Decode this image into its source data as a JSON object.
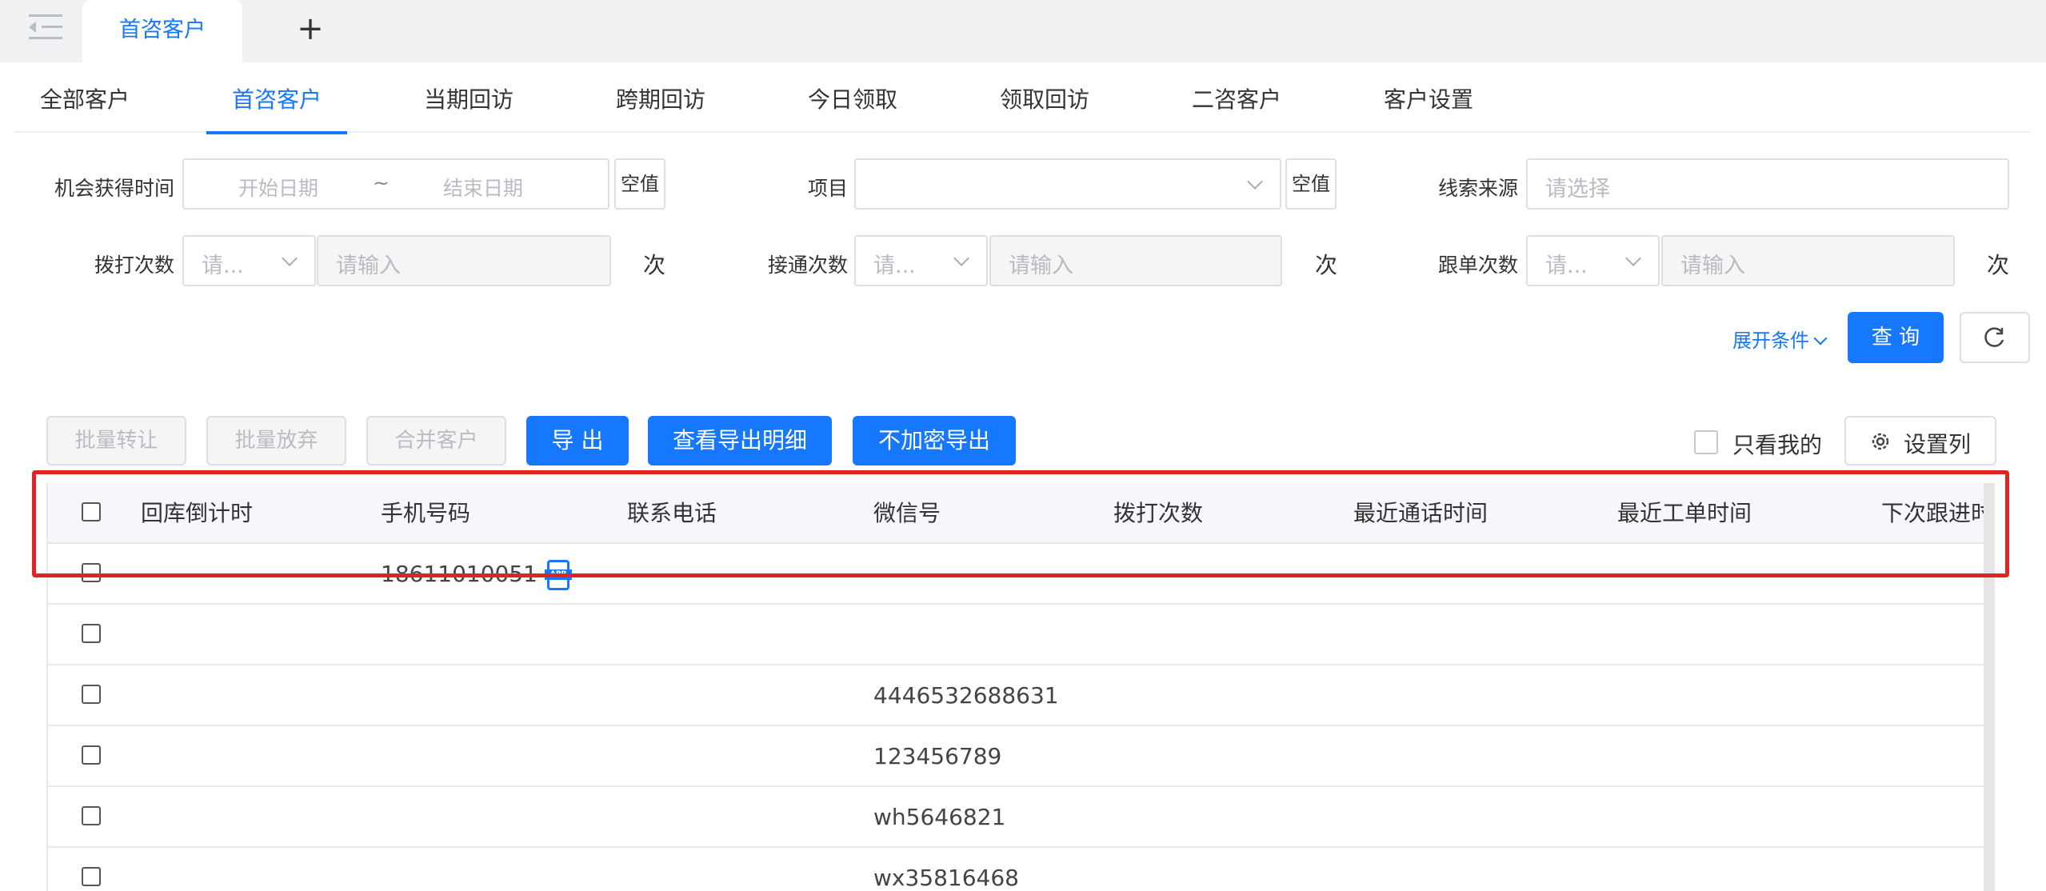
{
  "top_tabs": {
    "active": "首咨客户",
    "add": "+"
  },
  "nav_tabs": [
    "全部客户",
    "首咨客户",
    "当期回访",
    "跨期回访",
    "今日领取",
    "领取回访",
    "二咨客户",
    "客户设置"
  ],
  "filters": {
    "opp_time_label": "机会获得时间",
    "start_placeholder": "开始日期",
    "sep": "~",
    "end_placeholder": "结束日期",
    "null_btn": "空值",
    "project_label": "项目",
    "lead_source_label": "线索来源",
    "lead_source_placeholder": "请选择",
    "dial_label": "拨打次数",
    "connect_label": "接通次数",
    "follow_label": "跟单次数",
    "select_placeholder": "请...",
    "input_placeholder": "请输入",
    "unit": "次"
  },
  "actions": {
    "expand": "展开条件",
    "query": "查 询",
    "refresh_icon": "refresh-icon"
  },
  "toolbar": {
    "batch_transfer": "批量转让",
    "batch_abandon": "批量放弃",
    "merge": "合并客户",
    "export": "导 出",
    "view_export": "查看导出明细",
    "plain_export": "不加密导出",
    "only_mine": "只看我的",
    "set_columns": "设置列"
  },
  "table": {
    "columns": [
      "回库倒计时",
      "手机号码",
      "联系电话",
      "微信号",
      "拨打次数",
      "最近通话时间",
      "最近工单时间",
      "下次跟进时"
    ],
    "rows": [
      {
        "phone": "18611010051",
        "app_badge": "APP",
        "wechat": ""
      },
      {
        "phone": "",
        "wechat": ""
      },
      {
        "phone": "",
        "wechat": "4446532688631"
      },
      {
        "phone": "",
        "wechat": "123456789"
      },
      {
        "phone": "",
        "wechat": "wh5646821"
      },
      {
        "phone": "",
        "wechat": "wx35816468"
      }
    ]
  },
  "colors": {
    "primary": "#1677ff",
    "highlight": "#e02424"
  }
}
